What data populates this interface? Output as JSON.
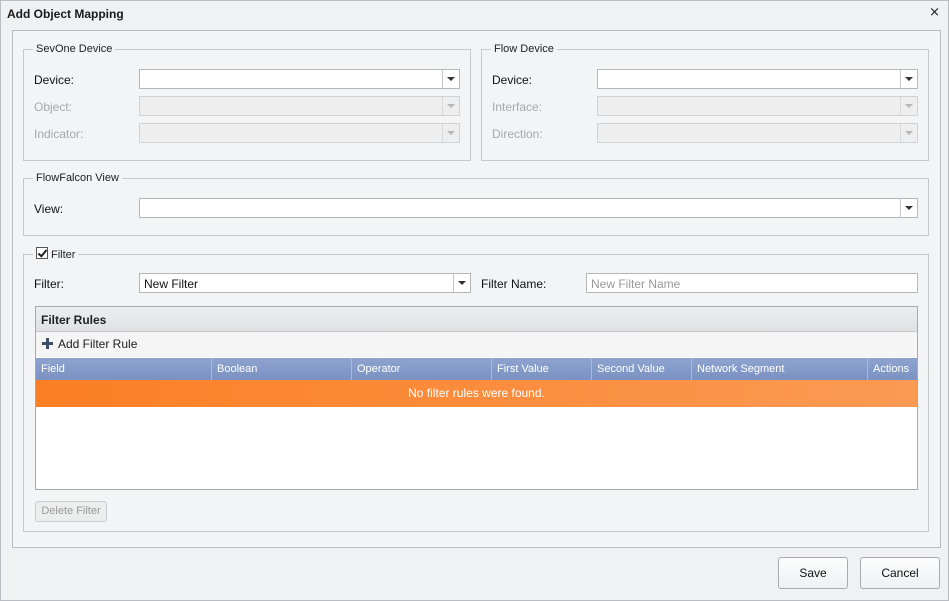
{
  "dialog": {
    "title": "Add Object Mapping",
    "close_symbol": "×"
  },
  "sevone": {
    "legend": "SevOne Device",
    "device_label": "Device:",
    "device_value": "",
    "object_label": "Object:",
    "object_value": "",
    "indicator_label": "Indicator:",
    "indicator_value": ""
  },
  "flow": {
    "legend": "Flow Device",
    "device_label": "Device:",
    "device_value": "",
    "interface_label": "Interface:",
    "interface_value": "",
    "direction_label": "Direction:",
    "direction_value": ""
  },
  "flowfalcon": {
    "legend": "FlowFalcon View",
    "view_label": "View:",
    "view_value": ""
  },
  "filter": {
    "legend": "Filter",
    "checked": true,
    "filter_label": "Filter:",
    "filter_value": "New Filter",
    "name_label": "Filter Name:",
    "name_placeholder": "New Filter Name",
    "rules_title": "Filter Rules",
    "add_rule_label": "Add Filter Rule",
    "columns": [
      "Field",
      "Boolean",
      "Operator",
      "First Value",
      "Second Value",
      "Network Segment",
      "Actions"
    ],
    "empty_message": "No filter rules were found.",
    "delete_label": "Delete Filter"
  },
  "footer": {
    "save_label": "Save",
    "cancel_label": "Cancel"
  },
  "colors": {
    "empty_banner": "#fb7f25",
    "column_header": "#8ea3cf"
  }
}
